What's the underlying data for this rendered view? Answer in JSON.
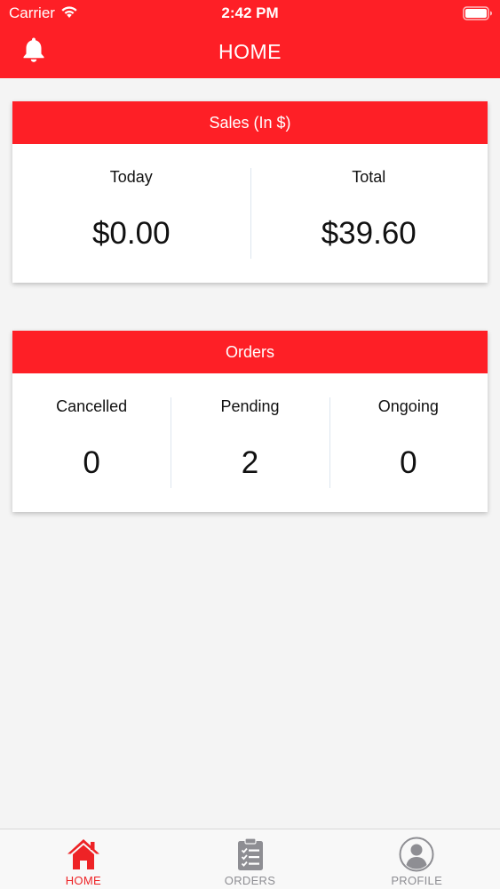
{
  "colors": {
    "accent": "#fe1f26",
    "background": "#f4f4f4",
    "card": "#ffffff",
    "tab_active": "#ee2326",
    "tab_inactive": "#8e8e93"
  },
  "status_bar": {
    "carrier": "Carrier",
    "time": "2:42 PM",
    "wifi_icon": "wifi-icon",
    "battery_icon": "battery-icon"
  },
  "nav": {
    "title": "HOME",
    "left_icon": "bell-icon"
  },
  "sales": {
    "title": "Sales (In $)",
    "stats": [
      {
        "label": "Today",
        "value": "$0.00"
      },
      {
        "label": "Total",
        "value": "$39.60"
      }
    ]
  },
  "orders": {
    "title": "Orders",
    "stats": [
      {
        "label": "Cancelled",
        "value": "0"
      },
      {
        "label": "Pending",
        "value": "2"
      },
      {
        "label": "Ongoing",
        "value": "0"
      }
    ]
  },
  "tabs": [
    {
      "label": "HOME",
      "icon": "home-icon",
      "active": true
    },
    {
      "label": "ORDERS",
      "icon": "clipboard-icon",
      "active": false
    },
    {
      "label": "PROFILE",
      "icon": "user-circle-icon",
      "active": false
    }
  ]
}
